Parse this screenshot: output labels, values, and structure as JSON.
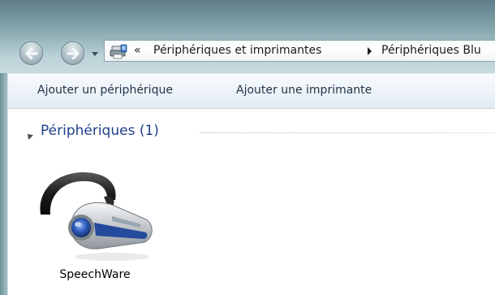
{
  "window": {
    "frame_color": "#86a6ad"
  },
  "navigation": {
    "back_icon": "back-arrow-icon",
    "forward_icon": "forward-arrow-icon",
    "dropdown_icon": "chevron-down-icon"
  },
  "address_bar": {
    "location_icon": "devices-and-printers-icon",
    "overflow_glyph": "«",
    "breadcrumbs": [
      "Périphériques et imprimantes",
      "Périphériques Blu"
    ]
  },
  "command_bar": {
    "add_device_label": "Ajouter un périphérique",
    "add_printer_label": "Ajouter une imprimante"
  },
  "content": {
    "group_title": "Périphériques (1)",
    "group_title_color": "#1e3f8a",
    "devices": [
      {
        "name": "SpeechWare",
        "icon": "bluetooth-headset-icon"
      }
    ]
  }
}
